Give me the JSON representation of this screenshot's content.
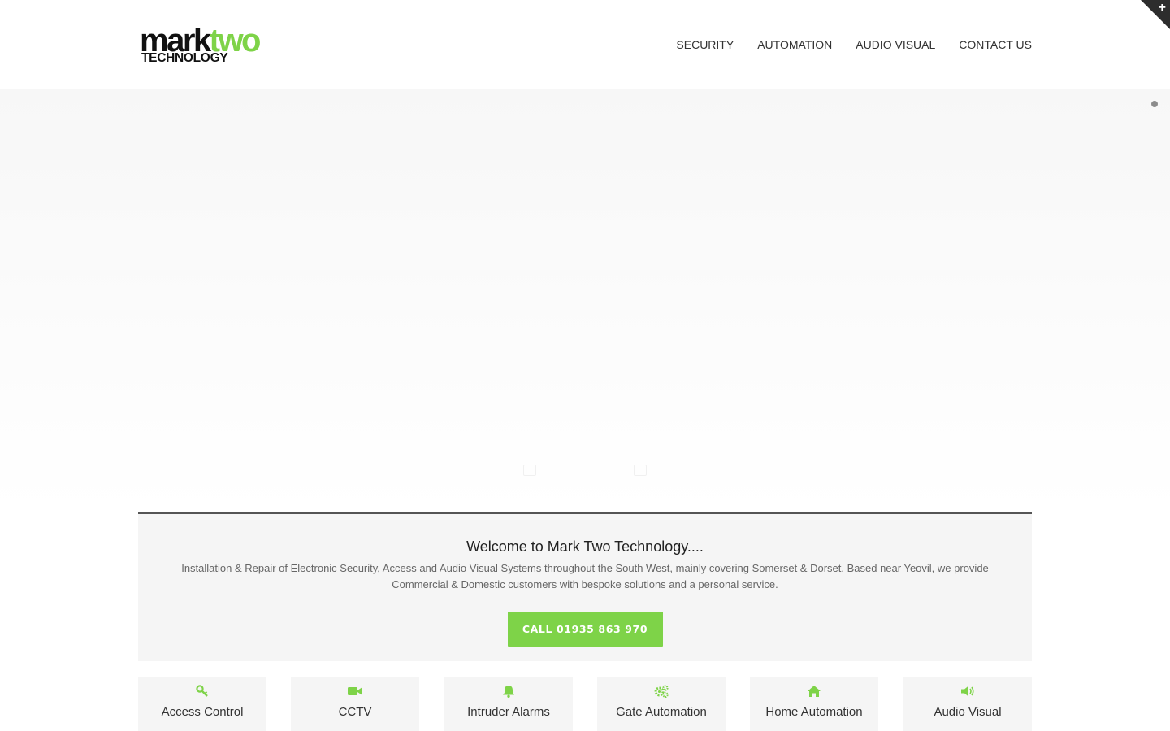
{
  "brand": {
    "mark": "mark",
    "two": "two",
    "technology": "TECHNOLOGY",
    "accent": "#7ed348"
  },
  "nav": [
    {
      "label": "SECURITY"
    },
    {
      "label": "AUTOMATION"
    },
    {
      "label": "AUDIO VISUAL"
    },
    {
      "label": "CONTACT US"
    }
  ],
  "corner_toggle": {
    "icon": "plus-icon",
    "glyph": "+"
  },
  "welcome": {
    "title": "Welcome to Mark Two Technology....",
    "text": "Installation & Repair of Electronic Security, Access and Audio Visual Systems throughout the South West, mainly covering Somerset & Dorset. Based near Yeovil, we provide Commercial & Domestic customers with bespoke solutions and a personal service.",
    "cta": "CALL 01935 863 970"
  },
  "services": [
    {
      "label": "Access Control",
      "icon": "key-icon"
    },
    {
      "label": "CCTV",
      "icon": "video-camera-icon"
    },
    {
      "label": "Intruder Alarms",
      "icon": "bell-icon"
    },
    {
      "label": "Gate Automation",
      "icon": "gears-icon"
    },
    {
      "label": "Home Automation",
      "icon": "home-icon"
    },
    {
      "label": "Audio Visual",
      "icon": "speaker-icon"
    }
  ]
}
